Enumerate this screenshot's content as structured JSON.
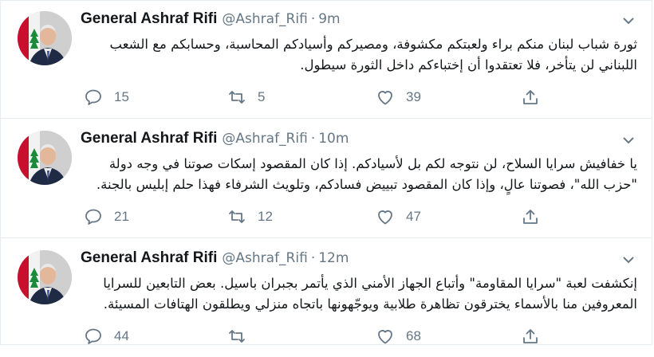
{
  "tweets": [
    {
      "author": "General Ashraf Rifi",
      "handle": "@Ashraf_Rifi",
      "separator": "·",
      "time": "9m",
      "text": "ثورة شباب لبنان منكم براء ولعبتكم مكشوفة، ومصيركم وأسيادكم المحاسبة، وحسابكم مع الشعب اللبناني لن يتأخر، فلا تعتقدوا أن إختباءكم داخل الثورة سيطول.",
      "replies": "15",
      "retweets": "5",
      "likes": "39"
    },
    {
      "author": "General Ashraf Rifi",
      "handle": "@Ashraf_Rifi",
      "separator": "·",
      "time": "10m",
      "text": "يا خفافيش سرايا السلاح، لن نتوجه لكم بل لأسيادكم. إذا كان المقصود إسكات صوتنا في وجه دولة \"حزب الله\"، فصوتنا عالٍ، وإذا كان المقصود تبييض فسادكم، وتلويث الشرفاء فهذا حلم إبليس بالجنة.",
      "replies": "21",
      "retweets": "12",
      "likes": "47"
    },
    {
      "author": "General Ashraf Rifi",
      "handle": "@Ashraf_Rifi",
      "separator": "·",
      "time": "12m",
      "text": "إنكشفت لعبة \"سرايا المقاومة\" وأتباع الجهاز الأمني الذي يأتمر بجبران باسيل. بعض التابعين للسرايا المعروفين منا بالأسماء يخترقون تظاهرة طلابية ويوجّهونها باتجاه منزلي ويطلقون الهتافات المسيئة.",
      "replies": "44",
      "retweets": "",
      "likes": "68"
    }
  ],
  "icons": {
    "reply": "reply-icon",
    "retweet": "retweet-icon",
    "like": "heart-icon",
    "share": "share-icon",
    "menu": "chevron-down-icon"
  },
  "colors": {
    "text": "#14171a",
    "secondary": "#657786",
    "divider": "#e6ecf0"
  }
}
